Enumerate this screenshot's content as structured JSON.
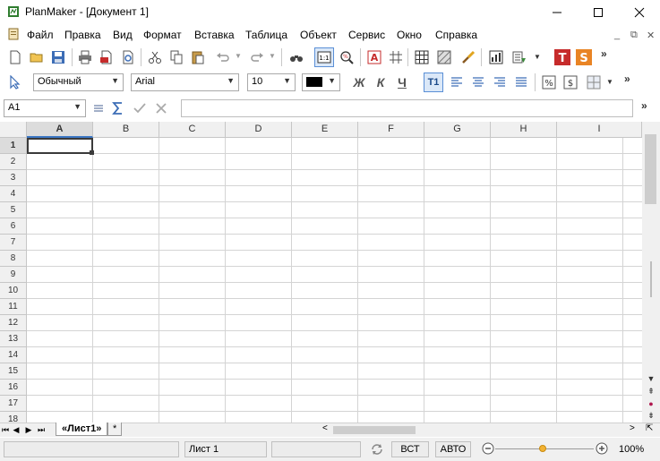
{
  "window": {
    "title": "PlanMaker - [Документ 1]",
    "minimize_glyph": "─",
    "maximize_glyph": "☐",
    "close_glyph": "✕"
  },
  "menu": {
    "items": [
      "Файл",
      "Правка",
      "Вид",
      "Формат",
      "Вставка",
      "Таблица",
      "Объект",
      "Сервис",
      "Окно",
      "Справка"
    ],
    "mdi_minimize": "_",
    "mdi_restore": "⧉",
    "mdi_close": "✕"
  },
  "toolbar_format": {
    "style": "Обычный",
    "font": "Arial",
    "size": "10",
    "bold": "Ж",
    "italic": "К",
    "underline": "Ч",
    "text_tool": "T1"
  },
  "formula_bar": {
    "cell_ref": "A1",
    "formula": ""
  },
  "grid": {
    "columns": [
      "A",
      "B",
      "C",
      "D",
      "E",
      "F",
      "G",
      "H",
      "I"
    ],
    "rows": [
      "1",
      "2",
      "3",
      "4",
      "5",
      "6",
      "7",
      "8",
      "9",
      "10",
      "11",
      "12",
      "13",
      "14",
      "15",
      "16",
      "17",
      "18"
    ],
    "active_cell": "A1"
  },
  "sheets": {
    "tabs": [
      "«Лист1»"
    ],
    "add_tab": "*"
  },
  "statusbar": {
    "sheet_name": "Лист 1",
    "insert_mode": "ВСТ",
    "auto_mode": "АВТО",
    "zoom": "100%"
  },
  "colors": {
    "accent": "#3b76c4",
    "font_color_swatch": "#000000"
  }
}
